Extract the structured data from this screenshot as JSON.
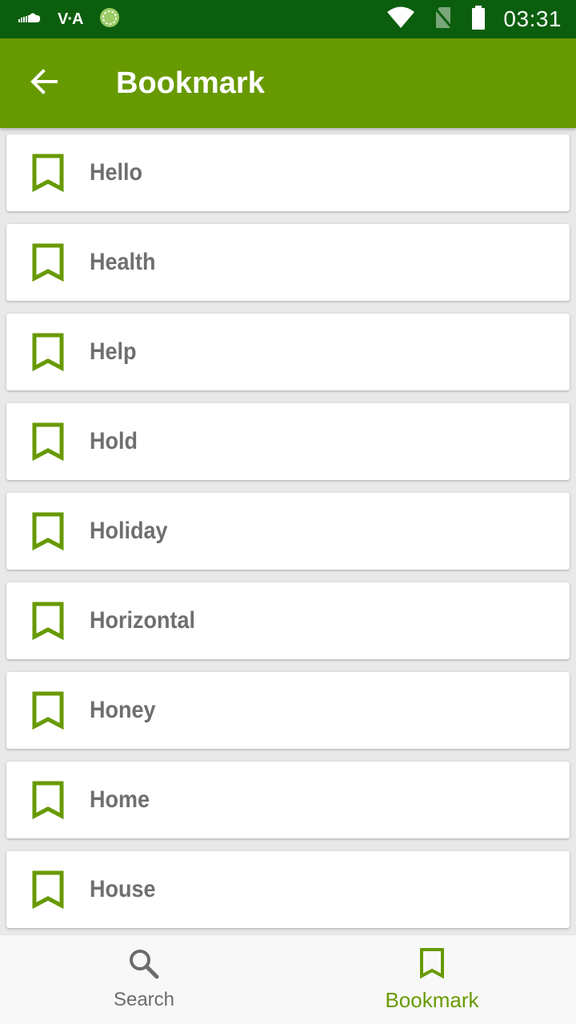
{
  "status_bar": {
    "time": "03:31",
    "vpn_label": "V·A"
  },
  "app_bar": {
    "title": "Bookmark"
  },
  "bookmarks": [
    {
      "label": "Hello"
    },
    {
      "label": "Health"
    },
    {
      "label": "Help"
    },
    {
      "label": "Hold"
    },
    {
      "label": "Holiday"
    },
    {
      "label": "Horizontal"
    },
    {
      "label": "Honey"
    },
    {
      "label": "Home"
    },
    {
      "label": "House"
    }
  ],
  "bottom_nav": {
    "search_label": "Search",
    "bookmark_label": "Bookmark"
  },
  "colors": {
    "status_bar": "#0b5e0e",
    "app_bar": "#679a00",
    "accent": "#679a00",
    "item_text": "#6f6f6f"
  }
}
